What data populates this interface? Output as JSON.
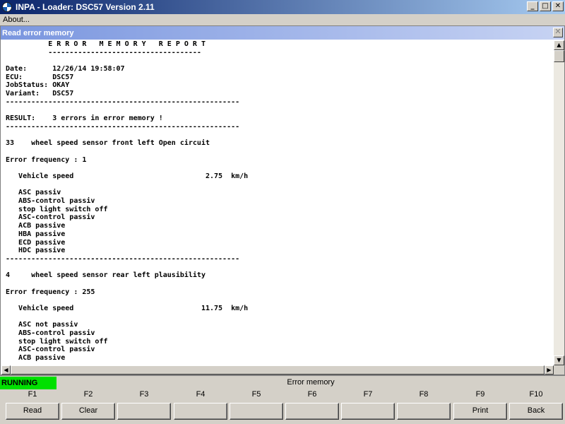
{
  "window": {
    "title": "INPA - Loader:  DSC57 Version 2.11",
    "min_glyph": "_",
    "max_glyph": "□",
    "close_glyph": "✕"
  },
  "menu": {
    "about": "About..."
  },
  "child_window": {
    "title": "Read error memory",
    "close_glyph": "✕"
  },
  "report": {
    "lines": [
      "          E R R O R   M E M O R Y   R E P O R T",
      "          ------------------------------------",
      "",
      "Date:      12/26/14 19:58:07",
      "ECU:       DSC57",
      "JobStatus: OKAY",
      "Variant:   DSC57",
      "-------------------------------------------------------",
      "",
      "RESULT:    3 errors in error memory !",
      "-------------------------------------------------------",
      "",
      "33    wheel speed sensor front left Open circuit",
      "",
      "Error frequency : 1",
      "",
      "   Vehicle speed                               2.75  km/h",
      "",
      "   ASC passiv",
      "   ABS-control passiv",
      "   stop light switch off",
      "   ASC-control passiv",
      "   ACB passive",
      "   HBA passive",
      "   ECD passive",
      "   HDC passive",
      "-------------------------------------------------------",
      "",
      "4     wheel speed sensor rear left plausibility",
      "",
      "Error frequency : 255",
      "",
      "   Vehicle speed                              11.75  km/h",
      "",
      "   ASC not passiv",
      "   ABS-control passiv",
      "   stop light switch off",
      "   ASC-control passiv",
      "   ACB passive"
    ]
  },
  "scroll": {
    "up": "▲",
    "down": "▼",
    "left": "◀",
    "right": "▶"
  },
  "status": {
    "state": "RUNNING",
    "state_color": "#00e000",
    "message": "Error memory"
  },
  "fkeys": [
    {
      "key": "F1",
      "label": "Read"
    },
    {
      "key": "F2",
      "label": "Clear"
    },
    {
      "key": "F3",
      "label": ""
    },
    {
      "key": "F4",
      "label": ""
    },
    {
      "key": "F5",
      "label": ""
    },
    {
      "key": "F6",
      "label": ""
    },
    {
      "key": "F7",
      "label": ""
    },
    {
      "key": "F8",
      "label": ""
    },
    {
      "key": "F9",
      "label": "Print"
    },
    {
      "key": "F10",
      "label": "Back"
    }
  ]
}
